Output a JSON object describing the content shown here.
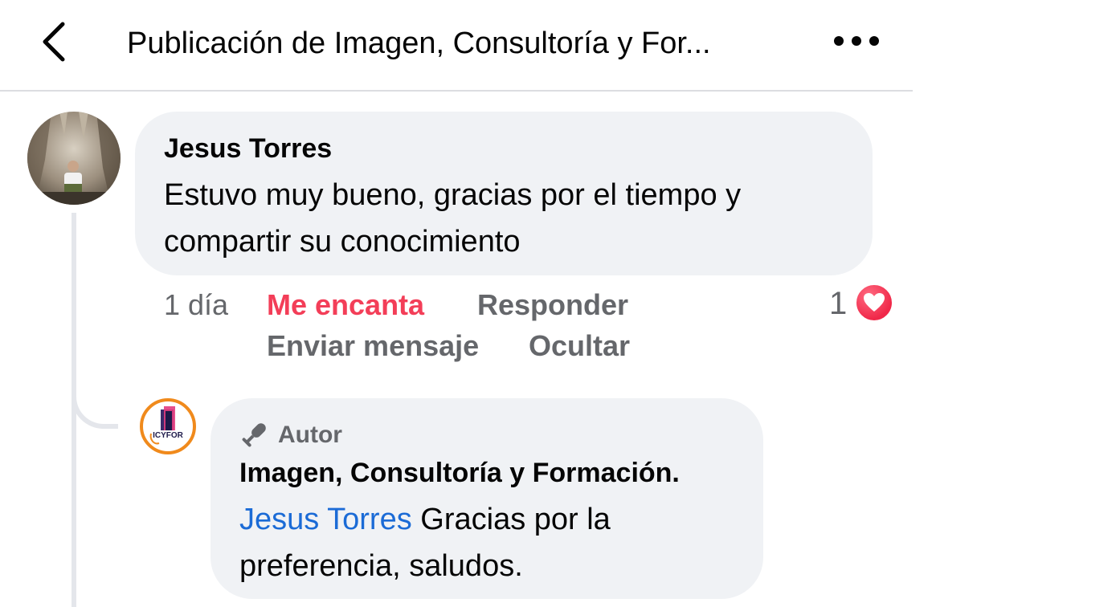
{
  "header": {
    "title": "Publicación de Imagen, Consultoría y For...",
    "back_icon": "chevron-left-icon",
    "more_icon": "more-horizontal-icon"
  },
  "comment": {
    "author": "Jesus Torres",
    "text": "Estuvo muy bueno, gracias por el tiempo y compartir su conocimiento",
    "time": "1 día",
    "reaction_label": "Me encanta",
    "reply_label": "Responder",
    "message_label": "Enviar mensaje",
    "hide_label": "Ocultar",
    "reaction_count": "1",
    "reaction_icon": "heart-icon"
  },
  "reply": {
    "badge_label": "Autor",
    "badge_icon": "microphone-icon",
    "author": "Imagen, Consultoría y Formación.",
    "mention": "Jesus Torres",
    "text": " Gracias por la preferencia, saludos.",
    "logo_text": "ICYFOR"
  },
  "colors": {
    "bubble_bg": "#f0f2f5",
    "love_red": "#f33e58",
    "mention_blue": "#1b6bd6",
    "secondary_text": "#65676b",
    "logo_ring": "#f08a1c"
  }
}
